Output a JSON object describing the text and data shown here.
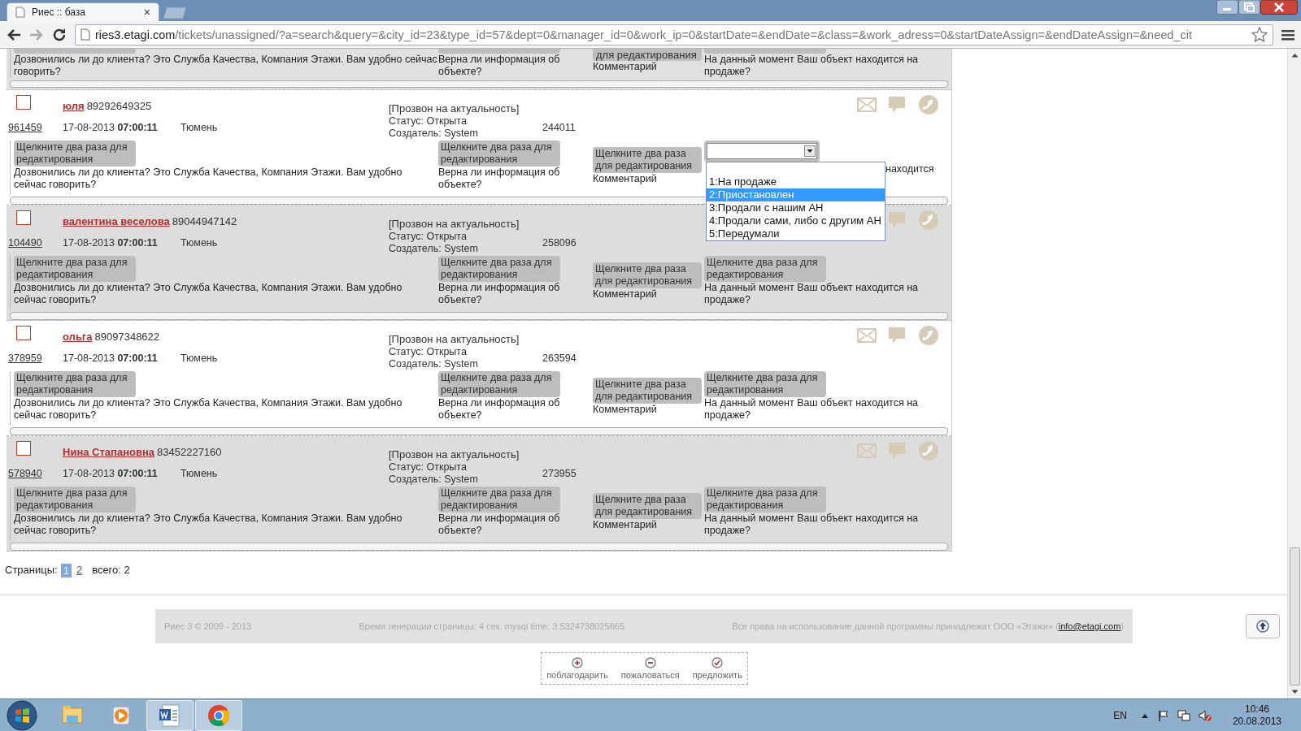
{
  "browser": {
    "tab_title": "Риес :: база",
    "tab_close": "×",
    "url_host": "ries3.etagi.com",
    "url_path": "/tickets/unassigned/?a=search&query=&city_id=23&type_id=57&dept=0&manager_id=0&work_ip=0&startDate=&endDate=&class=&work_adress=0&startDateAssign=&endDateAssign=&need_cit"
  },
  "partial_ticket": {
    "columns": [
      {
        "question": "Дозвонились ли до клиента? Это Служба Качества, Компания Этажи. Вам удобно сейчас говорить?"
      },
      {
        "question": "Верна ли информация об объекте?"
      },
      {
        "hint": "для редактирования",
        "question": "Комментарий"
      },
      {
        "question": "На данный момент Ваш объект находится на продаже?"
      }
    ]
  },
  "tickets": [
    {
      "shaded": false,
      "checked": false,
      "name": "юля",
      "phone": "89292649325",
      "task": "[Прозвон на актуальность]",
      "id": "961459",
      "date": "17-08-2013",
      "time": "07:00:11",
      "city": "Тюмень",
      "status": "Статус: Открыта",
      "creator": "Создатель: System",
      "number": "244011",
      "icons": [
        {
          "kind": "mail"
        },
        {
          "kind": "comment"
        },
        {
          "kind": "phone"
        }
      ],
      "columns": [
        {
          "kind": "hint",
          "hint": "Щелкните два раза для редактирования",
          "question": "Дозвонились ли до клиента? Это Служба Качества, Компания Этажи. Вам удобно сейчас говорить?"
        },
        {
          "kind": "hint",
          "hint": "Щелкните два раза для редактирования",
          "question": "Верна ли информация об объекте?"
        },
        {
          "kind": "hint",
          "hint": "Щелкните два раза для редактирования",
          "question": "Комментарий"
        },
        {
          "kind": "select",
          "question": "находится",
          "options": [
            {
              "label": "1:На продаже",
              "selected": false
            },
            {
              "label": "2:Приостановлен",
              "selected": true
            },
            {
              "label": "3:Продали с нашим АН",
              "selected": false
            },
            {
              "label": "4:Продали сами, либо с другим АН",
              "selected": false
            },
            {
              "label": "5:Передумали",
              "selected": false
            }
          ]
        }
      ]
    },
    {
      "shaded": true,
      "checked": false,
      "name": "валентина веселова",
      "phone": "89044947142",
      "task": "[Прозвон на актуальность]",
      "id": "104490",
      "date": "17-08-2013",
      "time": "07:00:11",
      "city": "Тюмень",
      "status": "Статус: Открыта",
      "creator": "Создатель: System",
      "number": "258096",
      "icons": [
        {
          "kind": "comment"
        },
        {
          "kind": "phone"
        }
      ],
      "columns": [
        {
          "kind": "hint",
          "hint": "Щелкните два раза для редактирования",
          "question": "Дозвонились ли до клиента? Это Служба Качества, Компания Этажи. Вам удобно сейчас говорить?"
        },
        {
          "kind": "hint",
          "hint": "Щелкните два раза для редактирования",
          "question": "Верна ли информация об объекте?"
        },
        {
          "kind": "hint",
          "hint": "Щелкните два раза для редактирования",
          "question": "Комментарий"
        },
        {
          "kind": "hint",
          "hint": "Щелкните два раза для редактирования",
          "question": "На данный момент Ваш объект находится на продаже?"
        }
      ]
    },
    {
      "shaded": false,
      "checked": false,
      "name": "ольга",
      "phone": "89097348622",
      "task": "[Прозвон на актуальность]",
      "id": "378959",
      "date": "17-08-2013",
      "time": "07:00:11",
      "city": "Тюмень",
      "status": "Статус: Открыта",
      "creator": "Создатель: System",
      "number": "263594",
      "icons": [
        {
          "kind": "mail"
        },
        {
          "kind": "comment"
        },
        {
          "kind": "phone"
        }
      ],
      "columns": [
        {
          "kind": "hint",
          "hint": "Щелкните два раза для редактирования",
          "question": "Дозвонились ли до клиента? Это Служба Качества, Компания Этажи. Вам удобно сейчас говорить?"
        },
        {
          "kind": "hint",
          "hint": "Щелкните два раза для редактирования",
          "question": "Верна ли информация об объекте?"
        },
        {
          "kind": "hint",
          "hint": "Щелкните два раза для редактирования",
          "question": "Комментарий"
        },
        {
          "kind": "hint",
          "hint": "Щелкните два раза для редактирования",
          "question": "На данный момент Ваш объект находится на продаже?"
        }
      ]
    },
    {
      "shaded": true,
      "checked": false,
      "name": "Нина Стапановна",
      "phone": "83452227160",
      "task": "[Прозвон на актуальность]",
      "id": "578940",
      "date": "17-08-2013",
      "time": "07:00:11",
      "city": "Тюмень",
      "status": "Статус: Открыта",
      "creator": "Создатель: System",
      "number": "273955",
      "icons": [
        {
          "kind": "mail"
        },
        {
          "kind": "comment"
        },
        {
          "kind": "phone"
        }
      ],
      "columns": [
        {
          "kind": "hint",
          "hint": "Щелкните два раза для редактирования",
          "question": "Дозвонились ли до клиента? Это Служба Качества, Компания Этажи. Вам удобно сейчас говорить?"
        },
        {
          "kind": "hint",
          "hint": "Щелкните два раза для редактирования",
          "question": "Верна ли информация об объекте?"
        },
        {
          "kind": "hint",
          "hint": "Щелкните два раза для редактирования",
          "question": "Комментарий"
        },
        {
          "kind": "hint",
          "hint": "Щелкните два раза для редактирования",
          "question": "На данный момент Ваш объект находится на продаже?"
        }
      ]
    }
  ],
  "pagination": {
    "label": "Страницы:",
    "pages": [
      {
        "label": "1",
        "selected": true
      },
      {
        "label": "2",
        "selected": false
      }
    ],
    "total": "всего: 2"
  },
  "footer": {
    "copyright": "Риес 3 © 2009 - 2013",
    "timing": "Время генерации страницы: 4 сек. mysql time: 3.5324738025665",
    "rights": "Все права на использование данной программы принадлежат ООО «Этажи» (",
    "email": "info@etagi.com",
    "rights_end": ")"
  },
  "actions": [
    {
      "kind": "plus",
      "label": "поблагодарить"
    },
    {
      "kind": "minus",
      "label": "пожаловаться"
    },
    {
      "kind": "check",
      "label": "предложить"
    }
  ],
  "taskbar": {
    "apps": [
      {
        "kind": "explorer",
        "running": false
      },
      {
        "kind": "media",
        "running": false
      },
      {
        "kind": "word",
        "running": true
      },
      {
        "kind": "chrome",
        "running": true
      }
    ],
    "lang": "EN",
    "time": "10:46",
    "date": "20.08.2013"
  }
}
